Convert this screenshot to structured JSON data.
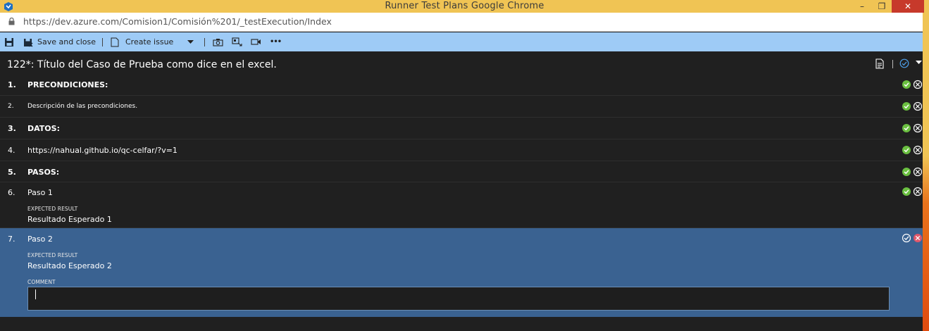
{
  "window": {
    "title": "Runner   Test Plans   Google Chrome",
    "min_glyph": "–",
    "max_glyph": "❐",
    "close_glyph": "✕"
  },
  "browser": {
    "url": "https://dev.azure.com/Comision1/Comisión%201/_testExecution/Index"
  },
  "toolbar": {
    "save_label": "Save and close",
    "create_issue_label": "Create issue",
    "more_label": "•••"
  },
  "test_case": {
    "title": "122*: Título del Caso de Prueba como dice en el excel."
  },
  "steps": [
    {
      "num": "1.",
      "text": "PRECONDICIONES:"
    },
    {
      "num": "2.",
      "text": "Descripción de las precondiciones."
    },
    {
      "num": "3.",
      "text": "DATOS:"
    },
    {
      "num": "4.",
      "text": "https://nahual.github.io/qc-celfar/?v=1"
    },
    {
      "num": "5.",
      "text": "PASOS:"
    },
    {
      "num": "6.",
      "text": "Paso 1",
      "expected_label": "EXPECTED RESULT",
      "expected": "Resultado Esperado 1"
    },
    {
      "num": "7.",
      "text": "Paso 2",
      "expected_label": "EXPECTED RESULT",
      "expected": "Resultado Esperado 2",
      "comment_label": "COMMENT"
    }
  ],
  "colors": {
    "pass": "#6abf40",
    "fail": "#e0576a",
    "selected_row": "#3a6291",
    "toolbar": "#9ecbf6",
    "titlebar": "#f0c454"
  }
}
